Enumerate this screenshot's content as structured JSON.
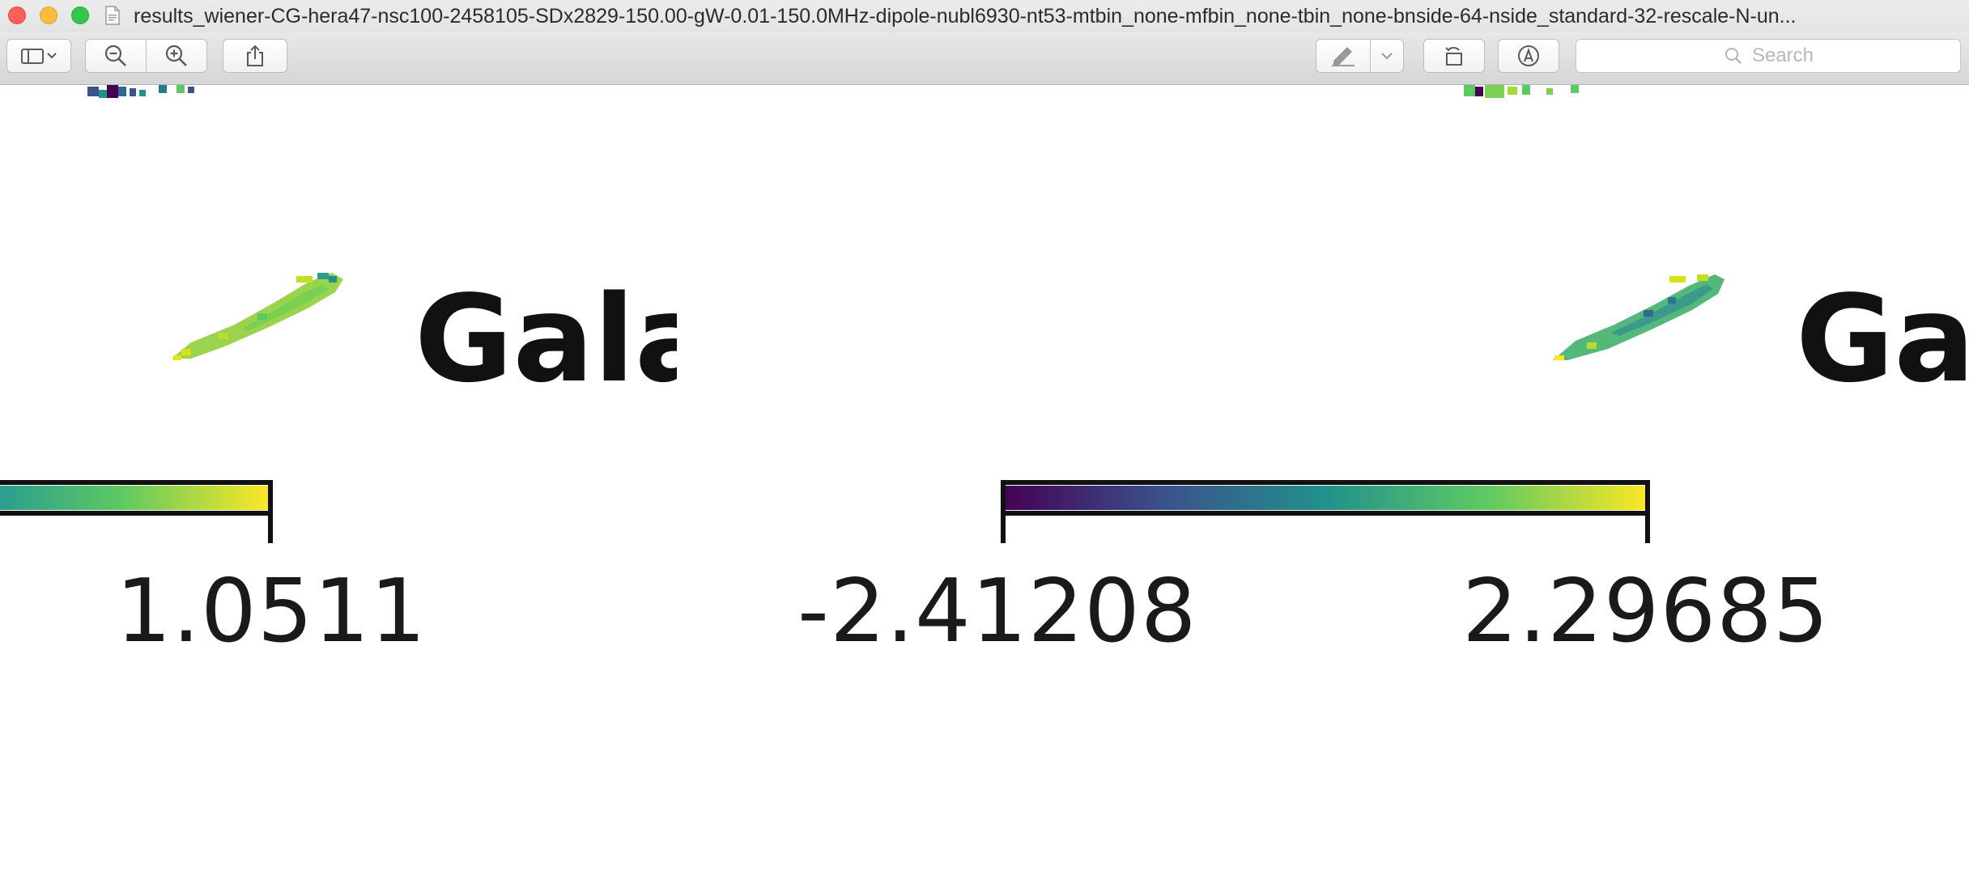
{
  "window": {
    "title": "results_wiener-CG-hera47-nsc100-2458105-SDx2829-150.00-gW-0.01-150.0MHz-dipole-nubl6930-nt53-mtbin_none-mfbin_none-tbin_none-bnside-64-nside_standard-32-rescale-N-un..."
  },
  "toolbar": {
    "search_placeholder": "Search",
    "icons": {
      "sidebar": "sidebar-toggle-icon",
      "zoom_out": "zoom-out-icon",
      "zoom_in": "zoom-in-icon",
      "share": "share-icon",
      "markup": "markup-pen-icon",
      "rotate": "rotate-icon",
      "annotate": "annotate-icon",
      "search": "search-icon"
    }
  },
  "document": {
    "left_panel": {
      "title_fragment": "Gala",
      "colorbar_max_label": "1.0511"
    },
    "right_panel": {
      "title_fragment": "Ga",
      "colorbar_min_label": "-2.41208",
      "colorbar_max_label": "2.29685"
    },
    "colormap": "viridis",
    "colors": {
      "viridis": [
        "#440154",
        "#3b528b",
        "#21918c",
        "#5ec962",
        "#fde725"
      ]
    }
  }
}
